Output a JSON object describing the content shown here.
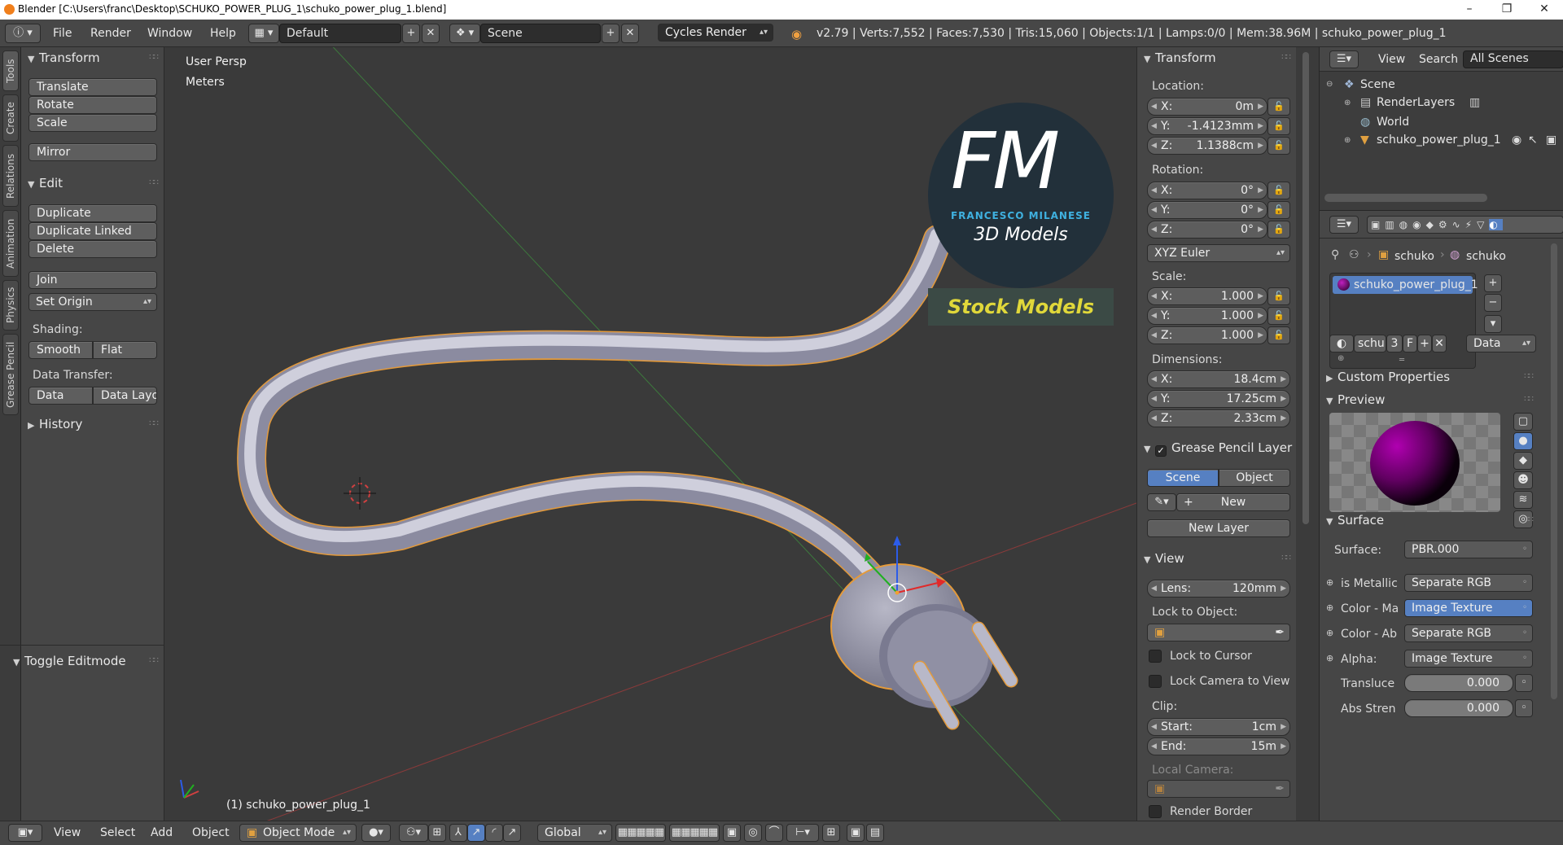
{
  "window": {
    "title": "Blender [C:\\Users\\franc\\Desktop\\SCHUKO_POWER_PLUG_1\\schuko_power_plug_1.blend]",
    "controls": [
      "–",
      "❐",
      "✕"
    ]
  },
  "topbar": {
    "menus": [
      "File",
      "Render",
      "Window",
      "Help"
    ],
    "layout": "Default",
    "scene": "Scene",
    "engine": "Cycles Render",
    "stats": "v2.79 | Verts:7,552 | Faces:7,530 | Tris:15,060 | Objects:1/1 | Lamps:0/0 | Mem:38.96M | schuko_power_plug_1"
  },
  "left_tabs": [
    "Tools",
    "Create",
    "Relations",
    "Animation",
    "Physics",
    "Grease Pencil"
  ],
  "toolshelf": {
    "transform_title": "Transform",
    "transform_buttons": [
      "Translate",
      "Rotate",
      "Scale",
      "Mirror"
    ],
    "edit_title": "Edit",
    "edit_buttons": [
      "Duplicate",
      "Duplicate Linked",
      "Delete",
      "Join"
    ],
    "set_origin": "Set Origin",
    "shading_label": "Shading:",
    "smooth": "Smooth",
    "flat": "Flat",
    "data_transfer_label": "Data Transfer:",
    "data": "Data",
    "data_layo": "Data Layo",
    "history": "History",
    "toggle_editmode": "Toggle Editmode"
  },
  "viewport": {
    "view_name": "User Persp",
    "units": "Meters",
    "object_label": "(1) schuko_power_plug_1",
    "logo_letters": "FM",
    "logo_name": "FRANCESCO MILANESE",
    "logo_sub": "3D Models",
    "stock_label": "Stock Models"
  },
  "npanel": {
    "transform_title": "Transform",
    "location_label": "Location:",
    "location": [
      {
        "k": "X:",
        "v": "0m"
      },
      {
        "k": "Y:",
        "v": "-1.4123mm"
      },
      {
        "k": "Z:",
        "v": "1.1388cm"
      }
    ],
    "rotation_label": "Rotation:",
    "rotation": [
      {
        "k": "X:",
        "v": "0°"
      },
      {
        "k": "Y:",
        "v": "0°"
      },
      {
        "k": "Z:",
        "v": "0°"
      }
    ],
    "rotation_mode": "XYZ Euler",
    "scale_label": "Scale:",
    "scale": [
      {
        "k": "X:",
        "v": "1.000"
      },
      {
        "k": "Y:",
        "v": "1.000"
      },
      {
        "k": "Z:",
        "v": "1.000"
      }
    ],
    "dimensions_label": "Dimensions:",
    "dimensions": [
      {
        "k": "X:",
        "v": "18.4cm"
      },
      {
        "k": "Y:",
        "v": "17.25cm"
      },
      {
        "k": "Z:",
        "v": "2.33cm"
      }
    ],
    "gp_title": "Grease Pencil Layer",
    "gp_scene": "Scene",
    "gp_object": "Object",
    "gp_new": "New",
    "gp_new_layer": "New Layer",
    "view_title": "View",
    "lens_label": "Lens:",
    "lens_value": "120mm",
    "lock_to_object": "Lock to Object:",
    "lock_to_cursor": "Lock to Cursor",
    "lock_camera": "Lock Camera to View",
    "clip_label": "Clip:",
    "clip_start_label": "Start:",
    "clip_start": "1cm",
    "clip_end_label": "End:",
    "clip_end": "15m",
    "local_camera": "Local Camera:",
    "render_border": "Render Border"
  },
  "outliner": {
    "view": "View",
    "search": "Search",
    "all_scenes": "All Scenes",
    "items": [
      "Scene",
      "RenderLayers",
      "World",
      "schuko_power_plug_1"
    ]
  },
  "props": {
    "crumb1": "schuko",
    "crumb2": "schuko",
    "material_slot": "schuko_power_plug_1",
    "mat_name": "schu",
    "mat_users": "3",
    "mat_f": "F",
    "data_dd": "Data",
    "custom_properties": "Custom Properties",
    "preview": "Preview",
    "surface_title": "Surface",
    "surface_label": "Surface:",
    "surface_value": "PBR.000",
    "inputs": [
      {
        "label": "is Metallic",
        "value": "Separate RGB",
        "active": false
      },
      {
        "label": "Color - Ma",
        "value": "Image Texture",
        "active": true
      },
      {
        "label": "Color - Ab",
        "value": "Separate RGB",
        "active": false
      },
      {
        "label": "Alpha:",
        "value": "Image Texture",
        "active": false
      }
    ],
    "translucence_label": "Transluce",
    "translucence": "0.000",
    "abs_label": "Abs Stren",
    "abs_value": "0.000"
  },
  "bottombar": {
    "menus": [
      "View",
      "Select",
      "Add",
      "Object"
    ],
    "mode": "Object Mode",
    "orientation": "Global"
  }
}
